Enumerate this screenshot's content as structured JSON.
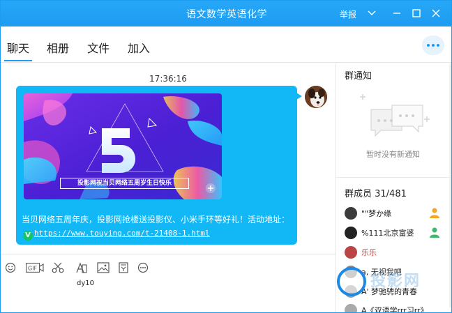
{
  "window": {
    "title": "语文数学英语化学",
    "report_label": "举报",
    "accent": "#1d9df2"
  },
  "tabs": [
    {
      "label": "聊天",
      "active": true
    },
    {
      "label": "相册",
      "active": false
    },
    {
      "label": "文件",
      "active": false
    },
    {
      "label": "加入",
      "active": false
    }
  ],
  "chat": {
    "timestamp": "17:36:16",
    "message": {
      "banner_caption": "投影网祝当贝网络五周岁生日快乐",
      "text": "当贝网络五周年庆，投影网抢楼送投影仪、小米手环等好礼！活动地址：",
      "link": "https://www.touying.com/t-21408-1.html",
      "badge": "V",
      "bubble_color": "#12b7f5"
    }
  },
  "input": {
    "draft": "dy10",
    "tools": [
      "emoji-icon",
      "gif-icon",
      "scissors-icon",
      "font-icon",
      "image-icon",
      "shake-icon",
      "more-icon"
    ],
    "gif_label": "GIF"
  },
  "side": {
    "notice_title": "群通知",
    "no_notice_text": "暂时没有新通知",
    "members_title": "群成员 31/481",
    "members": [
      {
        "name": "\"\"梦か缘",
        "color": "#222222",
        "role": "admin"
      },
      {
        "name": "%111北京富婆",
        "color": "#222222",
        "role": "owner"
      },
      {
        "name": "乐乐",
        "color": "#e03b3b",
        "role": ""
      },
      {
        "name": "a, 无视我吧",
        "color": "#222222",
        "role": ""
      },
      {
        "name": "A' 梦驰骋的青春",
        "color": "#222222",
        "role": ""
      },
      {
        "name": "A《双语学rrr习rr》",
        "color": "#222222",
        "role": ""
      }
    ]
  },
  "watermark": {
    "text": "投影网"
  }
}
